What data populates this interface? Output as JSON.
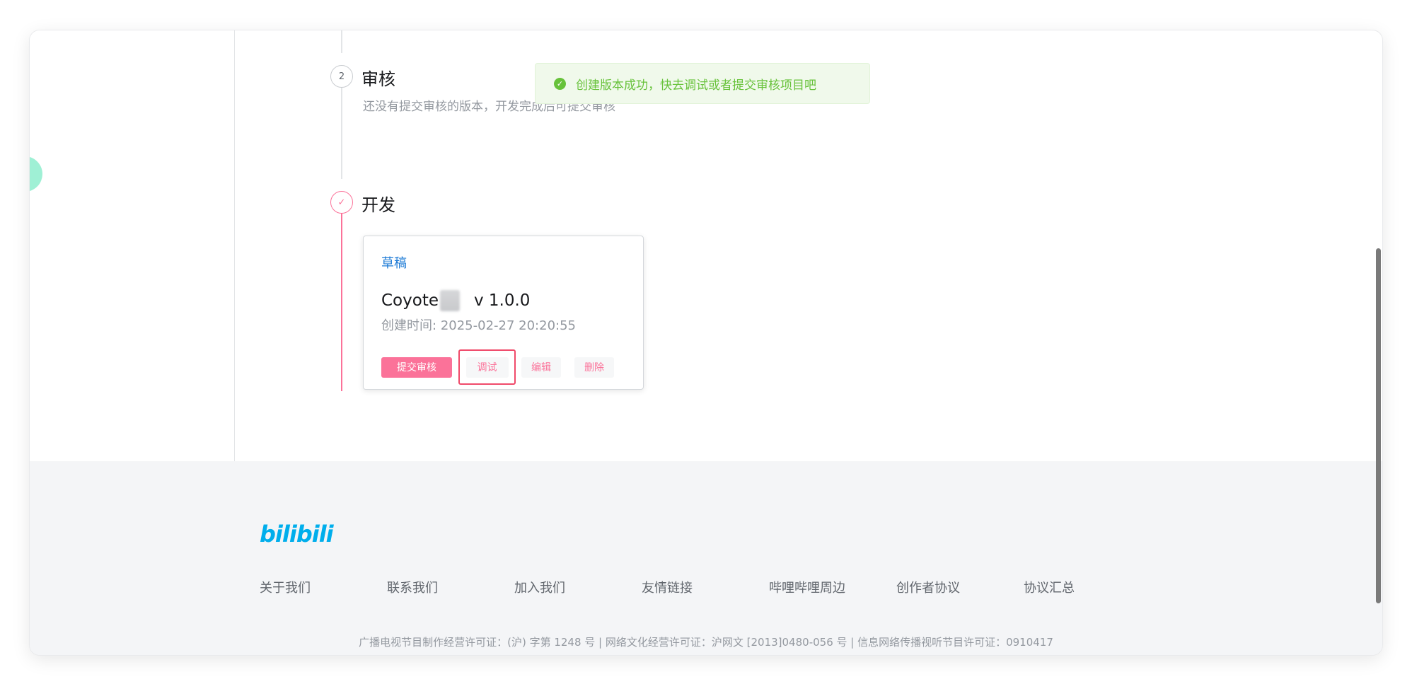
{
  "toast": {
    "message": "创建版本成功，快去调试或者提交审核项目吧",
    "icon": "check-circle-icon",
    "color": "#67c23a"
  },
  "steps": [
    {
      "number": "2",
      "title": "审核",
      "description": "还没有提交审核的版本，开发完成后可提交审核"
    },
    {
      "title": "开发",
      "icon": "check-icon"
    }
  ],
  "card": {
    "status": "草稿",
    "name": "Coyote",
    "version": "v 1.0.0",
    "created_label": "创建时间:",
    "created_time": "2025-02-27 20:20:55",
    "actions": {
      "submit": "提交审核",
      "debug": "调试",
      "edit": "编辑",
      "delete": "删除"
    }
  },
  "footer": {
    "logo": "bilibili",
    "links": [
      "关于我们",
      "联系我们",
      "加入我们",
      "友情链接",
      "哔哩哔哩周边",
      "创作者协议",
      "协议汇总"
    ],
    "license": "广播电视节目制作经营许可证：(沪) 字第 1248 号 | 网络文化经营许可证：沪网文 [2013]0480-056 号 | 信息网络传播视听节目许可证：0910417"
  },
  "colors": {
    "accent": "#fb7299",
    "link": "#1e7bd6",
    "brand": "#00aeec"
  }
}
